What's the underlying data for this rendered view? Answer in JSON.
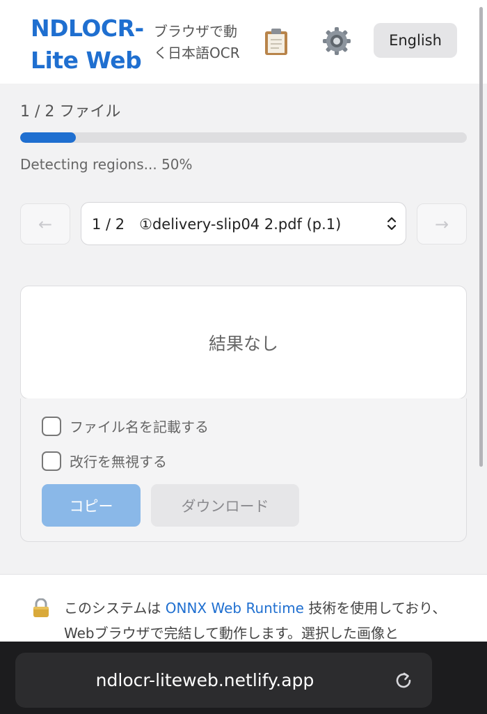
{
  "header": {
    "brand_line1": "NDLOCR-",
    "brand_line2": "Lite Web",
    "tagline_line1": "ブラウザで動",
    "tagline_line2": "く日本語OCR",
    "clipboard_icon": "clipboard-icon",
    "settings_icon": "gear-icon",
    "language_button": "English"
  },
  "progress": {
    "file_count": "1 / 2 ファイル",
    "fraction": 0.125,
    "status": "Detecting regions... 50%"
  },
  "navigation": {
    "prev_symbol": "←",
    "next_symbol": "→",
    "file_select_value": "1 / 2　①delivery-slip04 2.pdf (p.1)"
  },
  "result": {
    "empty_text": "結果なし"
  },
  "options": {
    "include_filename": "ファイル名を記載する",
    "ignore_linebreaks": "改行を無視する",
    "copy_button": "コピー",
    "download_button": "ダウンロード"
  },
  "notice": {
    "text_before": "このシステムは ",
    "link": "ONNX Web Runtime",
    "text_after": " 技術を使用しており、Webブラウザで完結して動作します。選択した画像と"
  },
  "browser": {
    "url": "ndlocr-liteweb.netlify.app"
  },
  "colors": {
    "brand": "#1f6fd0",
    "copy_button_bg": "#8ab8e8"
  }
}
